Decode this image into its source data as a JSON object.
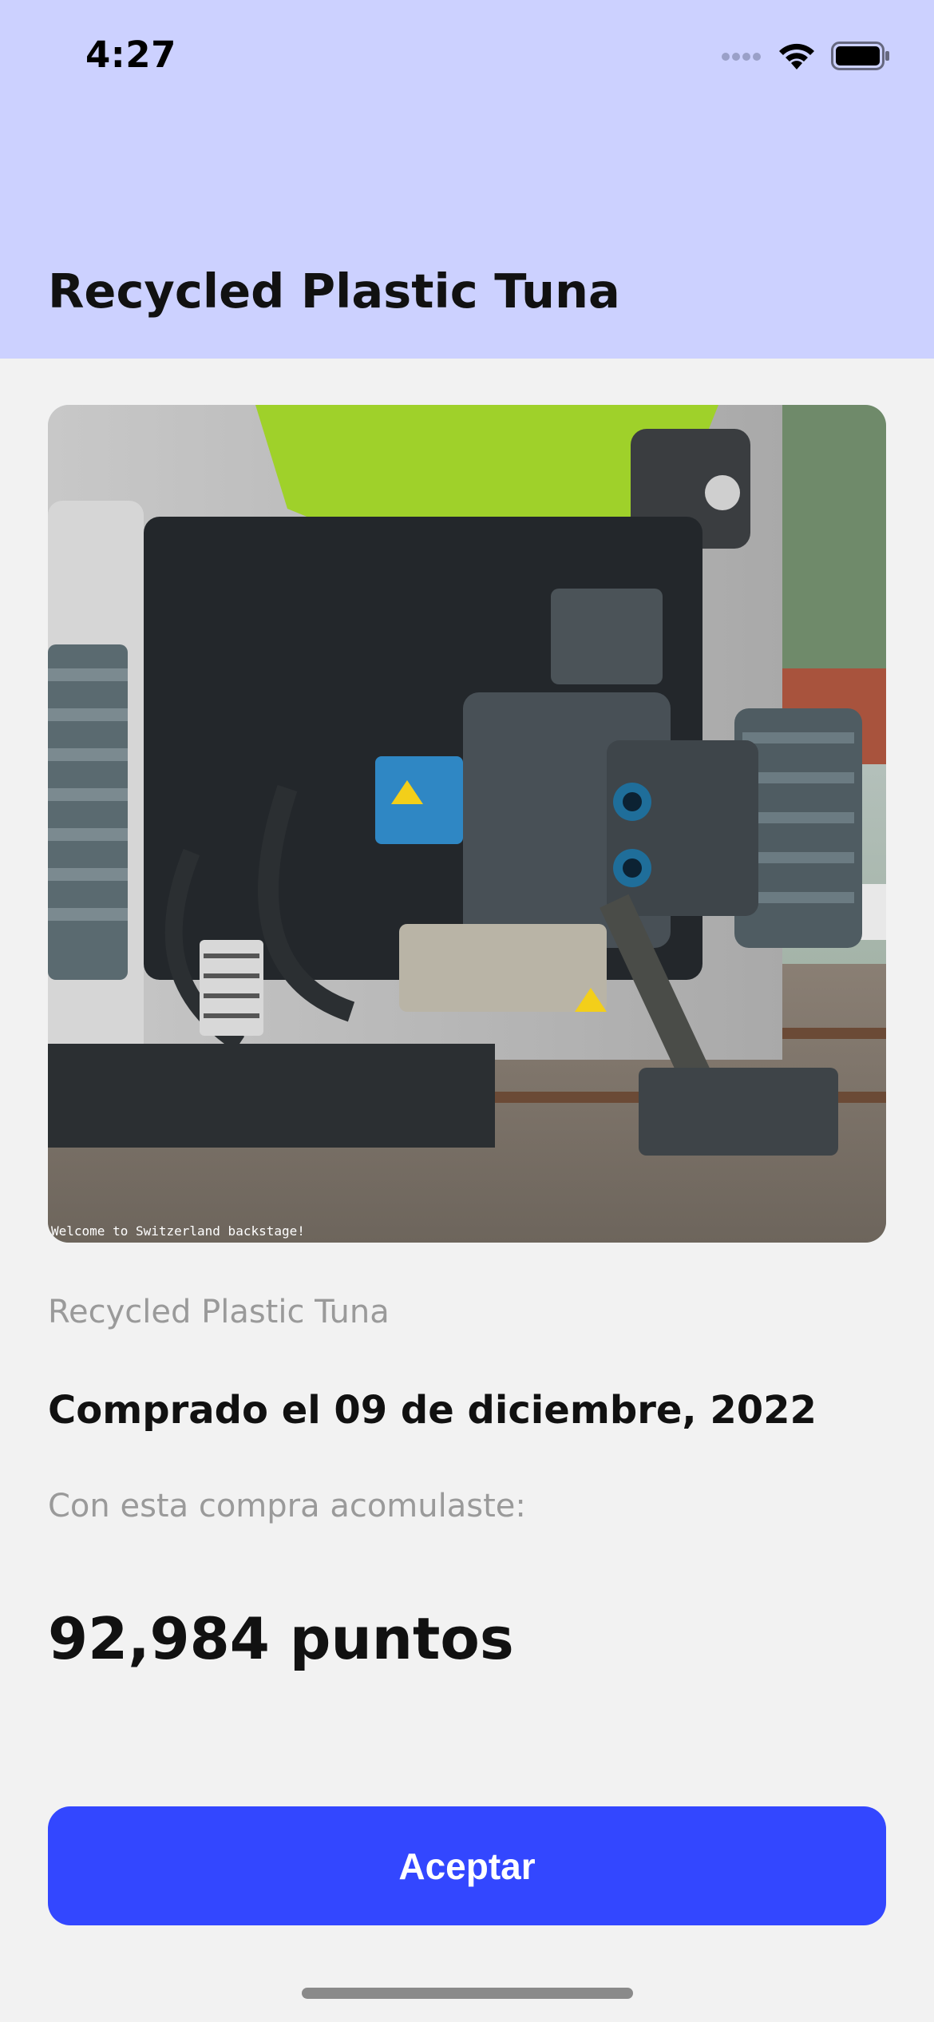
{
  "status_bar": {
    "time": "4:27",
    "icons": [
      "cellular-signal-icon",
      "wifi-icon",
      "battery-icon"
    ]
  },
  "header": {
    "title": "Recycled Plastic Tuna",
    "background": "#ccd1ff"
  },
  "product": {
    "image_caption": "Welcome to Switzerland backstage!",
    "name": "Recycled Plastic Tuna",
    "purchase_date": "Comprado el 09 de diciembre, 2022",
    "points_caption": "Con esta compra acomulaste:",
    "points_value": "92,984 puntos"
  },
  "actions": {
    "accept_label": "Aceptar",
    "accept_color": "#3347ff"
  }
}
